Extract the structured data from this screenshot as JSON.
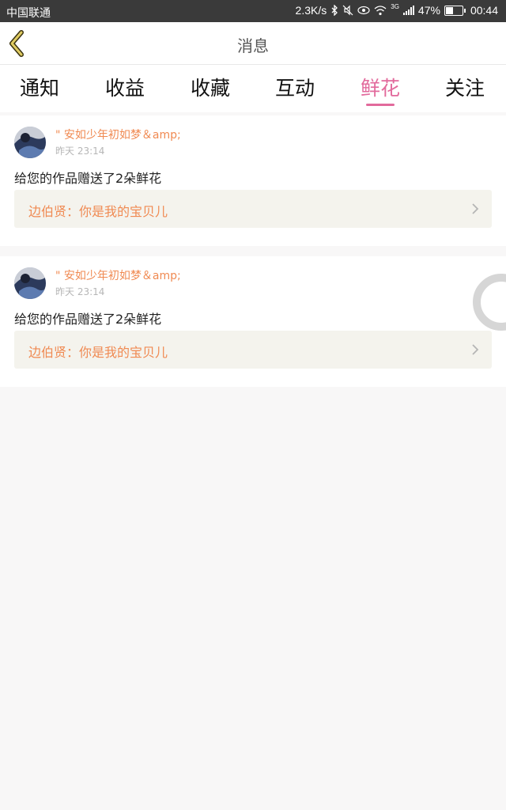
{
  "status_bar": {
    "carrier": "中国联通",
    "speed": "2.3K/s",
    "signal_label": "3G",
    "battery": "47%",
    "battery_level": 0.47,
    "time": "00:44"
  },
  "header": {
    "title": "消息",
    "back_icon": "chevron-left-icon"
  },
  "tabs": [
    {
      "label": "通知",
      "active": false
    },
    {
      "label": "收益",
      "active": false
    },
    {
      "label": "收藏",
      "active": false
    },
    {
      "label": "互动",
      "active": false
    },
    {
      "label": "鲜花",
      "active": true
    },
    {
      "label": "关注",
      "active": false
    }
  ],
  "messages": [
    {
      "user": "\" 安如少年初如梦＆amp;",
      "time": "昨天 23:14",
      "text": "给您的作品赠送了2朵鲜花",
      "work": "边伯贤：你是我的宝贝儿"
    },
    {
      "user": "\" 安如少年初如梦＆amp;",
      "time": "昨天 23:14",
      "text": "给您的作品赠送了2朵鲜花",
      "work": "边伯贤：你是我的宝贝儿"
    }
  ],
  "colors": {
    "accent": "#e26a9c",
    "username": "#f08a52",
    "link_bg": "#f4f3ed",
    "status_bar": "#3a3a3a"
  }
}
